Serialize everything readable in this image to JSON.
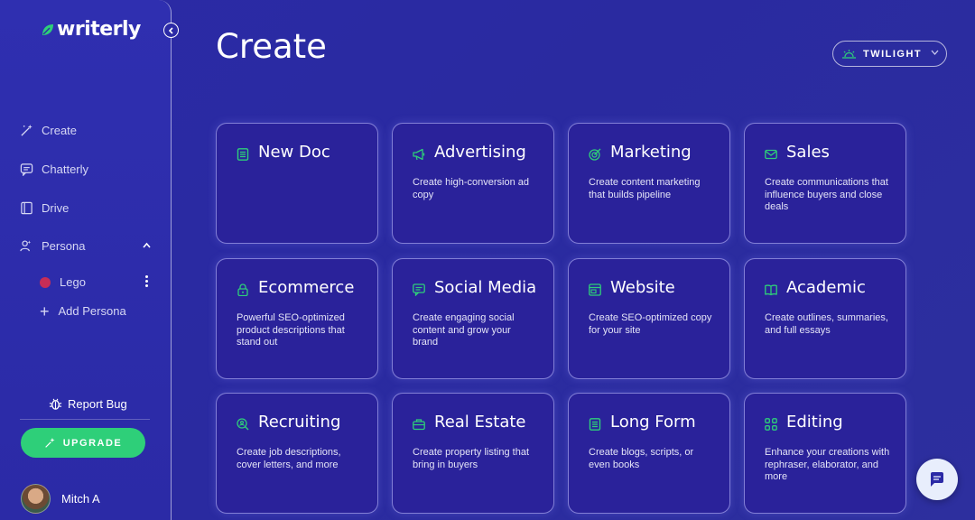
{
  "app": {
    "name": "writerly"
  },
  "sidebar": {
    "nav": [
      {
        "label": "Create",
        "icon": "magic-wand-icon"
      },
      {
        "label": "Chatterly",
        "icon": "chat-icon"
      },
      {
        "label": "Drive",
        "icon": "drive-icon"
      },
      {
        "label": "Persona",
        "icon": "persona-icon"
      }
    ],
    "persona_items": [
      {
        "label": "Lego",
        "color": "#c72d57"
      }
    ],
    "add_persona_label": "Add Persona",
    "report_bug_label": "Report Bug",
    "upgrade_label": "UPGRADE",
    "user_name": "Mitch A"
  },
  "header": {
    "title": "Create",
    "theme_select": {
      "selected": "TWILIGHT"
    }
  },
  "colors": {
    "accent": "#2ecf79",
    "background": "#2b2aa6",
    "card": "#2a229a"
  },
  "cards": [
    {
      "title": "New Doc",
      "desc": "",
      "icon": "document-icon"
    },
    {
      "title": "Advertising",
      "desc": "Create high-conversion ad copy",
      "icon": "megaphone-icon"
    },
    {
      "title": "Marketing",
      "desc": "Create content marketing that builds pipeline",
      "icon": "target-icon"
    },
    {
      "title": "Sales",
      "desc": "Create communications that influence buyers and close deals",
      "icon": "mail-icon"
    },
    {
      "title": "Ecommerce",
      "desc": "Powerful SEO-optimized product descriptions that stand out",
      "icon": "lock-icon"
    },
    {
      "title": "Social Media",
      "desc": "Create engaging social content and grow your brand",
      "icon": "message-icon"
    },
    {
      "title": "Website",
      "desc": "Create SEO-optimized copy for your site",
      "icon": "browser-icon"
    },
    {
      "title": "Academic",
      "desc": "Create outlines, summaries, and full essays",
      "icon": "book-icon"
    },
    {
      "title": "Recruiting",
      "desc": "Create job descriptions, cover letters, and more",
      "icon": "search-person-icon"
    },
    {
      "title": "Real Estate",
      "desc": "Create property listing that bring in buyers",
      "icon": "briefcase-icon"
    },
    {
      "title": "Long Form",
      "desc": "Create blogs, scripts, or even books",
      "icon": "document-icon"
    },
    {
      "title": "Editing",
      "desc": "Enhance your creations with rephraser, elaborator, and more",
      "icon": "grid-icon"
    }
  ]
}
